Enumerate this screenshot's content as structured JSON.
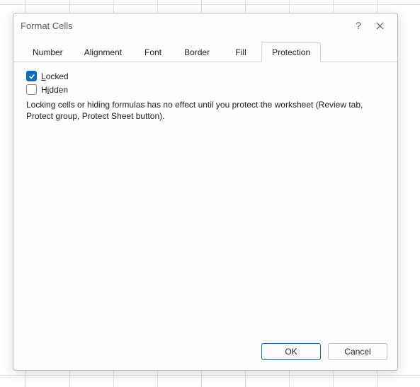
{
  "dialog": {
    "title": "Format Cells",
    "help_tooltip": "?",
    "tabs": [
      {
        "label": "Number"
      },
      {
        "label": "Alignment"
      },
      {
        "label": "Font"
      },
      {
        "label": "Border"
      },
      {
        "label": "Fill"
      },
      {
        "label": "Protection"
      }
    ],
    "active_tab_index": 5
  },
  "protection": {
    "locked": {
      "checked": true,
      "label_prefix": "L",
      "label_rest": "ocked"
    },
    "hidden": {
      "checked": false,
      "label_prefix": "",
      "label_underline": "i",
      "label_before": "H",
      "label_after": "dden"
    },
    "description": "Locking cells or hiding formulas has no effect until you protect the worksheet (Review tab, Protect group, Protect Sheet button)."
  },
  "footer": {
    "ok": "OK",
    "cancel": "Cancel"
  }
}
